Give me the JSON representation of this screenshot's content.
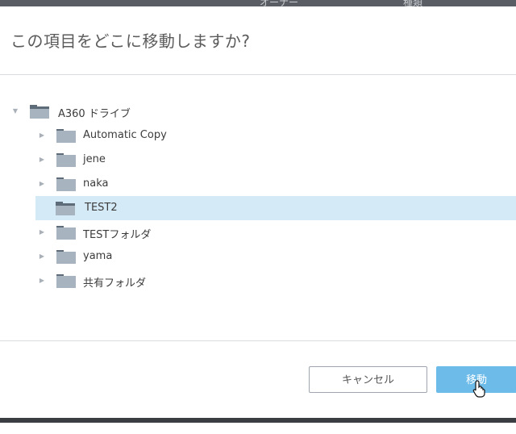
{
  "background": {
    "header_col_owner": "オーナー",
    "header_col_type": "種類"
  },
  "dialog": {
    "title": "この項目をどこに移動しますか?",
    "tree": {
      "root": {
        "label": "A360 ドライブ",
        "icon": "folder-open-icon",
        "expanded": true
      },
      "children": [
        {
          "label": "Automatic Copy",
          "icon": "folder-icon",
          "has_children": true
        },
        {
          "label": "jene",
          "icon": "folder-icon",
          "has_children": true
        },
        {
          "label": "naka",
          "icon": "folder-icon",
          "has_children": true
        },
        {
          "label": "TEST2",
          "icon": "folder-open-icon",
          "has_children": false,
          "selected": true
        },
        {
          "label": "TESTフォルダ",
          "icon": "folder-icon",
          "has_children": true
        },
        {
          "label": "yama",
          "icon": "folder-icon",
          "has_children": true
        },
        {
          "label": "共有フォルダ",
          "icon": "folder-icon",
          "has_children": true
        }
      ]
    },
    "buttons": {
      "cancel_label": "キャンセル",
      "move_label": "移動"
    }
  },
  "colors": {
    "accent": "#6cbbe9",
    "selection": "#d5eaf7",
    "folder": "#a7b4c0",
    "folder_tab": "#5e6b78"
  }
}
